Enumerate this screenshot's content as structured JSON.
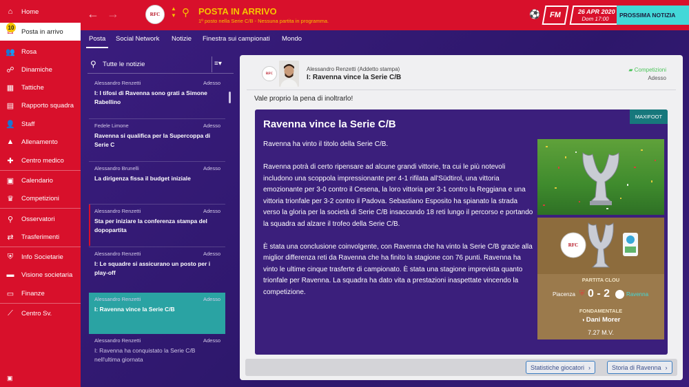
{
  "sidebar": {
    "badge": "10",
    "items": [
      {
        "label": "Home",
        "icon": "home-icon"
      },
      {
        "label": "Posta in arrivo",
        "icon": "inbox-icon"
      },
      {
        "label": "Rosa",
        "icon": "squad-icon"
      },
      {
        "label": "Dinamiche",
        "icon": "dynamics-icon"
      },
      {
        "label": "Tattiche",
        "icon": "tactics-icon"
      },
      {
        "label": "Rapporto squadra",
        "icon": "report-icon"
      },
      {
        "label": "Staff",
        "icon": "staff-icon"
      },
      {
        "label": "Allenamento",
        "icon": "training-icon"
      },
      {
        "label": "Centro medico",
        "icon": "medical-icon"
      },
      {
        "label": "Calendario",
        "icon": "calendar-icon"
      },
      {
        "label": "Competizioni",
        "icon": "trophy-icon"
      },
      {
        "label": "Osservatori",
        "icon": "scouting-icon"
      },
      {
        "label": "Trasferimenti",
        "icon": "transfers-icon"
      },
      {
        "label": "Info Societarie",
        "icon": "club-info-icon"
      },
      {
        "label": "Visione societaria",
        "icon": "vision-icon"
      },
      {
        "label": "Finanze",
        "icon": "finance-icon"
      },
      {
        "label": "Centro Sv.",
        "icon": "development-icon"
      }
    ]
  },
  "topbar": {
    "club_logo": "RFC",
    "title": "POSTA IN ARRIVO",
    "subtitle": "1º posto nella Serie C/B - Nessuna partita in programma.",
    "fm": "FM",
    "date": "26 APR 2020",
    "day_time": "Dom 17:00",
    "next_button": "PROSSIMA NOTIZIA",
    "colors": {
      "primary": "#d8102b",
      "accent": "#f5c400",
      "highlight": "#43d8d8"
    }
  },
  "tabs": [
    "Posta",
    "Social Network",
    "Notizie",
    "Finestra sui campionati",
    "Mondo"
  ],
  "news_list": {
    "header": "Tutte le notizie",
    "items": [
      {
        "author": "Alessandro Renzetti",
        "time": "Adesso",
        "headline": "I: I tifosi di Ravenna sono grati a Simone Rabellino"
      },
      {
        "author": "Fedele Limone",
        "time": "Adesso",
        "headline": "Ravenna si qualifica per la Supercoppa di Serie C"
      },
      {
        "author": "Alessandro Brunelli",
        "time": "Adesso",
        "headline": "La dirigenza fissa il budget iniziale"
      },
      {
        "author": "Alessandro Renzetti",
        "time": "Adesso",
        "headline": "Sta per iniziare la conferenza stampa del dopopartita"
      },
      {
        "author": "Alessandro Renzetti",
        "time": "Adesso",
        "headline": "I: Le squadre si assicurano un posto per i play-off"
      },
      {
        "author": "Alessandro Renzetti",
        "time": "Adesso",
        "headline": "I: Ravenna vince la Serie C/B"
      },
      {
        "author": "Alessandro Renzetti",
        "time": "Adesso",
        "headline": "I: Ravenna ha conquistato la Serie C/B nell'ultima giornata"
      }
    ]
  },
  "message": {
    "club_logo": "RFC",
    "sender": "Alessandro Renzetti  (Addetto stampa)",
    "subject": "I: Ravenna vince la Serie C/B",
    "tag": "Competizioni",
    "time": "Adesso",
    "intro": "Vale proprio la pena di inoltrarlo!",
    "source": "MAXIFOOT",
    "article_title": "Ravenna vince la Serie C/B",
    "paragraphs": [
      "Ravenna ha vinto il titolo della Serie C/B.",
      "Ravenna potrà di certo ripensare ad alcune grandi vittorie, tra cui le più notevoli includono una scoppola impressionante per 4-1 rifilata all'Südtirol, una vittoria emozionante per 3-0 contro il Cesena, la loro vittoria per 3-1 contro la Reggiana e una vittoria trionfale per 3-2 contro il Padova. Sebastiano Esposito ha spianato la strada verso la gloria per la società di Serie C/B insaccando 18 reti lungo il percorso e portando la squadra ad alzare il trofeo della Serie C/B.",
      "È stata una conclusione coinvolgente, con Ravenna che ha vinto la Serie C/B grazie alla miglior differenza reti da Ravenna che ha finito la stagione con 76 punti. Ravenna ha vinto le ultime cinque trasferte di campionato. È stata una stagione imprevista quanto trionfale per Ravenna. La squadra ha dato vita a prestazioni inaspettate vincendo la competizione."
    ],
    "card": {
      "logo_left": "RFC",
      "match_label": "PARTITA CLOU",
      "home": "Piacenza",
      "score": "0 - 2",
      "away": "Ravenna",
      "key_label": "FONDAMENTALE",
      "player": "Dani Morer",
      "rating": "7.27 M.V."
    },
    "buttons": [
      "Statistiche giocatori",
      "Storia di Ravenna"
    ]
  }
}
